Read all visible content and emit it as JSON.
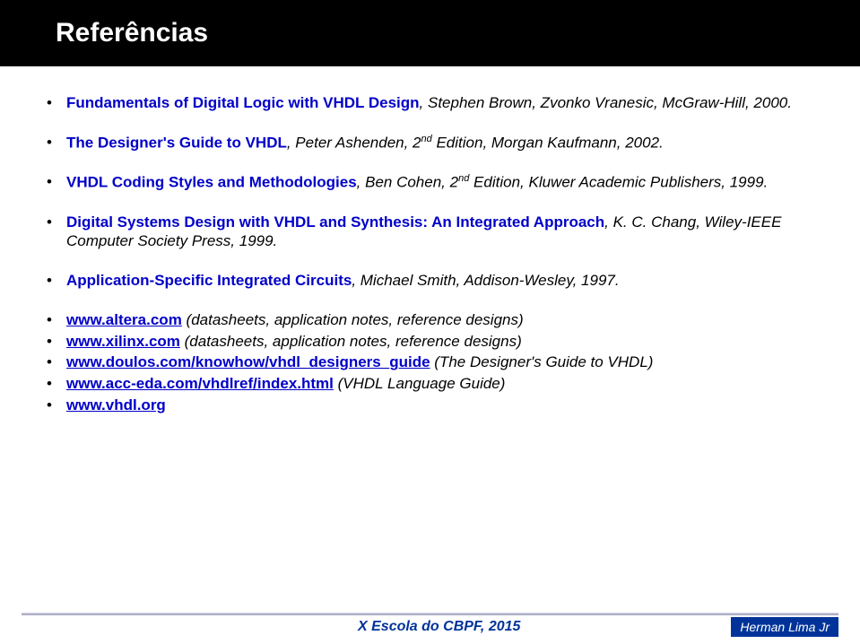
{
  "title": "Referências",
  "refs": [
    {
      "lead": "Fundamentals of Digital Logic with VHDL Design",
      "rest": ", Stephen Brown, Zvonko Vranesic, McGraw-Hill, 2000."
    },
    {
      "lead": "The Designer's Guide to VHDL",
      "rest_a": ", Peter Ashenden, 2",
      "sup": "nd",
      "rest_b": " Edition, Morgan Kaufmann, 2002."
    },
    {
      "lead": "VHDL Coding Styles and Methodologies",
      "rest_a": ", Ben Cohen, 2",
      "sup": "nd",
      "rest_b": " Edition, Kluwer Academic Publishers, 1999."
    },
    {
      "lead": "Digital Systems Design with VHDL and Synthesis: An Integrated Approach",
      "rest": ", K. C. Chang, Wiley-IEEE Computer Society Press, 1999."
    },
    {
      "lead": "Application-Specific Integrated Circuits",
      "rest": ", Michael Smith, Addison-Wesley, 1997."
    }
  ],
  "links": [
    {
      "url": "www.altera.com",
      "rest": " (datasheets, application notes, reference designs)"
    },
    {
      "url": "www.xilinx.com",
      "rest": " (datasheets, application notes, reference designs)"
    },
    {
      "url": "www.doulos.com/knowhow/vhdl_designers_guide",
      "rest": " (The Designer's Guide to VHDL)"
    },
    {
      "url": "www.acc-eda.com/vhdlref/index.html",
      "rest": " (VHDL Language Guide)"
    },
    {
      "url": "www.vhdl.org",
      "rest": ""
    }
  ],
  "footer": {
    "event": "X Escola do CBPF, 2015",
    "author": "Herman Lima Jr"
  }
}
